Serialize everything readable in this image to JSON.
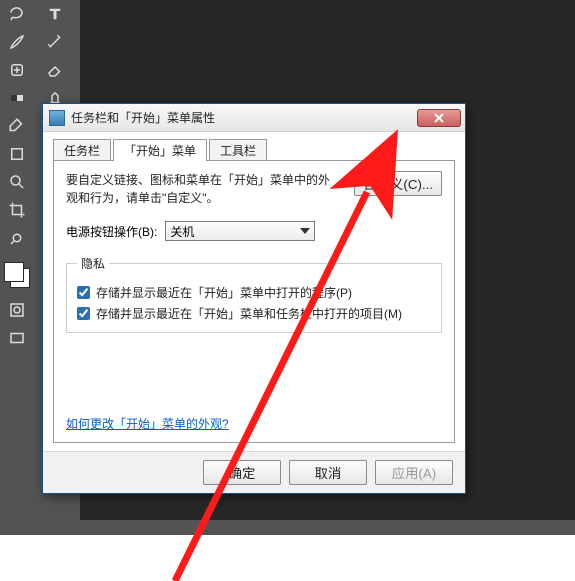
{
  "window": {
    "title": "任务栏和「开始」菜单属性"
  },
  "tabs": {
    "taskbar": "任务栏",
    "start_menu": "「开始」菜单",
    "toolbars": "工具栏"
  },
  "start_panel": {
    "description": "要自定义链接、图标和菜单在「开始」菜单中的外观和行为，请单击\"自定义\"。",
    "customize_button": "自定义(C)...",
    "power_label": "电源按钮操作(B):",
    "power_value": "关机",
    "privacy_legend": "隐私",
    "privacy_check1": "存储并显示最近在「开始」菜单中打开的程序(P)",
    "privacy_check2": "存储并显示最近在「开始」菜单和任务栏中打开的项目(M)",
    "help_link": "如何更改「开始」菜单的外观?"
  },
  "footer": {
    "ok": "确定",
    "cancel": "取消",
    "apply": "应用(A)"
  },
  "icons": {
    "move": "move-icon",
    "type": "type-icon",
    "lasso": "lasso-icon",
    "wand": "wand-icon",
    "brush": "brush-icon",
    "eraser": "eraser-icon",
    "spot": "spot-heal-icon",
    "clone": "clone-stamp-icon",
    "gradient": "gradient-icon",
    "pen": "pen-icon",
    "dodge": "dodge-icon",
    "shape": "shape-icon",
    "hand": "hand-icon",
    "zoom": "zoom-icon",
    "crop": "crop-icon",
    "eyedrop": "eyedropper-icon",
    "text": "text-icon"
  }
}
